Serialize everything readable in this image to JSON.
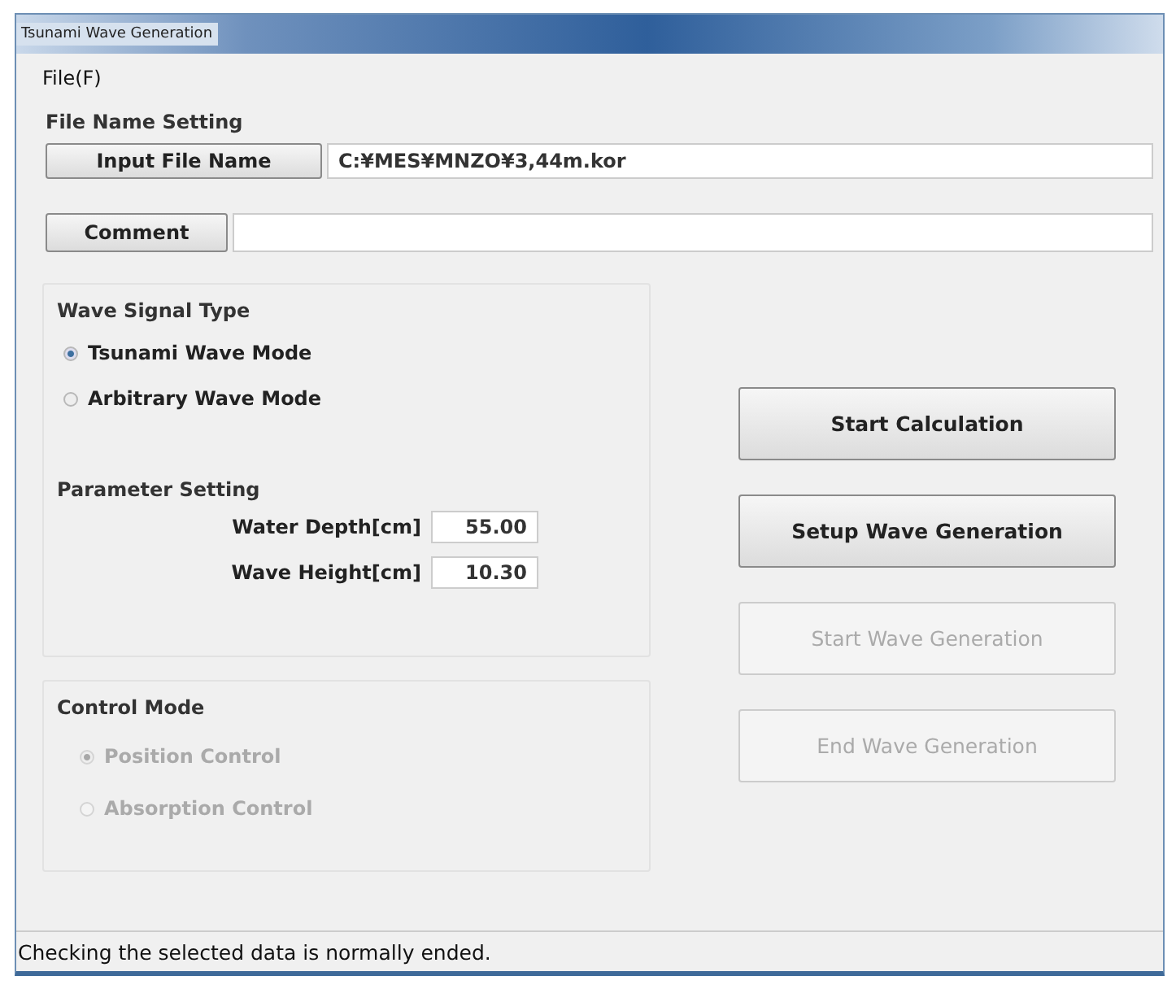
{
  "window": {
    "title": "Tsunami Wave Generation"
  },
  "menu": [
    {
      "label": "File(F)"
    }
  ],
  "file_name_setting": {
    "title": "File Name Setting",
    "input_file": {
      "button": "Input File Name",
      "value": "C:¥MES¥MNZO¥3,44m.kor"
    },
    "comment": {
      "button": "Comment"
    }
  },
  "wave_signal_type": {
    "title": "Wave Signal Type",
    "options": [
      {
        "label": "Tsunami Wave Mode",
        "selected": true,
        "disabled": false
      },
      {
        "label": "Arbitrary Wave Mode",
        "selected": false,
        "disabled": false
      }
    ]
  },
  "parameter_setting": {
    "title": "Parameter Setting",
    "fields": [
      {
        "label": "Water Depth[cm]",
        "value": "55.00"
      },
      {
        "label": "Wave Height[cm]",
        "value": "10.30"
      }
    ]
  },
  "control_mode": {
    "title": "Control Mode",
    "options": [
      {
        "label": "Position Control",
        "selected": true,
        "disabled": true
      },
      {
        "label": "Absorption Control",
        "selected": false,
        "disabled": true
      }
    ]
  },
  "buttons": [
    {
      "label": "Start Calculation",
      "disabled": false
    },
    {
      "label": "Setup Wave Generation",
      "disabled": false
    },
    {
      "label": "Start Wave Generation",
      "disabled": true
    },
    {
      "label": "End Wave Generation",
      "disabled": true
    }
  ],
  "status_bar": "Checking the selected data is normally ended."
}
